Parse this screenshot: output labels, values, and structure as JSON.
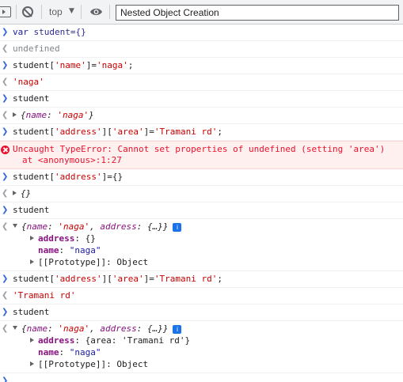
{
  "toolbar": {
    "context": "top",
    "filter_value": "Nested Object Creation"
  },
  "rows": {
    "r1": {
      "kw": "var",
      "rest": " student={}"
    },
    "r2": {
      "text": "undefined"
    },
    "r3": {
      "pre": "student[",
      "s1": "'name'",
      "mid": "]=",
      "s2": "'naga'",
      "post": ";"
    },
    "r4": {
      "text": "'naga'"
    },
    "r5": {
      "text": "student"
    },
    "r6": {
      "open": "{",
      "k": "name",
      "sep": ": ",
      "v": "'naga'",
      "close": "}"
    },
    "r7": {
      "pre": "student[",
      "s1": "'address'",
      "mid1": "][",
      "s2": "'area'",
      "mid2": "]=",
      "s3": "'Tramani rd'",
      "post": ";"
    },
    "r8": {
      "line1": "Uncaught TypeError: Cannot set properties of undefined (setting 'area')",
      "line2": "at <anonymous>:1:27"
    },
    "r9": {
      "pre": "student[",
      "s1": "'address'",
      "post": "]={}"
    },
    "r10": {
      "text": "{}"
    },
    "r11": {
      "text": "student"
    },
    "r12": {
      "summary_open": "{",
      "k1": "name",
      "sep1": ": ",
      "v1": "'naga'",
      "comma": ", ",
      "k2": "address",
      "sep2": ": ",
      "v2": "{…}",
      "close": "}",
      "badge": "i",
      "children": [
        {
          "key": "address",
          "sep": ": ",
          "val": "{}"
        },
        {
          "key": "name",
          "sep": ": ",
          "val": "\"naga\""
        },
        {
          "key": "[[Prototype]]",
          "sep": ": ",
          "val": "Object"
        }
      ]
    },
    "r13": {
      "pre": "student[",
      "s1": "'address'",
      "mid1": "][",
      "s2": "'area'",
      "mid2": "]=",
      "s3": "'Tramani rd'",
      "post": ";"
    },
    "r14": {
      "text": "'Tramani rd'"
    },
    "r15": {
      "text": "student"
    },
    "r16": {
      "summary_open": "{",
      "k1": "name",
      "sep1": ": ",
      "v1": "'naga'",
      "comma": ", ",
      "k2": "address",
      "sep2": ": ",
      "v2": "{…}",
      "close": "}",
      "badge": "i",
      "children": [
        {
          "key": "address",
          "sep": ": ",
          "val": "{area: 'Tramani rd'}"
        },
        {
          "key": "name",
          "sep": ": ",
          "val": "\"naga\""
        },
        {
          "key": "[[Prototype]]",
          "sep": ": ",
          "val": "Object"
        }
      ]
    }
  }
}
